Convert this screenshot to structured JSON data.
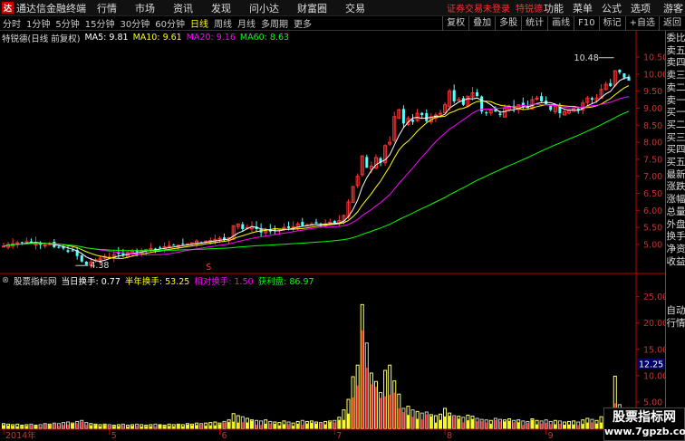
{
  "app": {
    "title": "通达信金融终端",
    "logo_glyph": "达"
  },
  "menu": [
    "行情",
    "市场",
    "资讯",
    "发现",
    "问小达",
    "财富圈",
    "交易"
  ],
  "notice": {
    "text": "证券交易未登录",
    "name": "特锐德"
  },
  "right_menu": [
    "功能",
    "菜单",
    "公式",
    "选项",
    "游客"
  ],
  "periods": [
    {
      "label": "分时",
      "active": false
    },
    {
      "label": "1分钟",
      "active": false
    },
    {
      "label": "5分钟",
      "active": false
    },
    {
      "label": "15分钟",
      "active": false
    },
    {
      "label": "30分钟",
      "active": false
    },
    {
      "label": "60分钟",
      "active": false
    },
    {
      "label": "日线",
      "active": true
    },
    {
      "label": "周线",
      "active": false
    },
    {
      "label": "月线",
      "active": false
    },
    {
      "label": "多周期",
      "active": false
    },
    {
      "label": "更多",
      "active": false
    }
  ],
  "tools": [
    "复权",
    "叠加",
    "多股",
    "统计",
    "画线",
    "F10",
    "标记",
    "+自选",
    "返回"
  ],
  "ma_line": {
    "stock": "特锐德(日线 前复权)",
    "items": [
      {
        "label": "MA5: 9.81",
        "color": "#ffffff"
      },
      {
        "label": "MA10: 9.61",
        "color": "#ffff00"
      },
      {
        "label": "MA20: 9.16",
        "color": "#ff00ff"
      },
      {
        "label": "MA60: 8.63",
        "color": "#00ff00"
      }
    ]
  },
  "indicator_line": {
    "name": "股票指标网",
    "items": [
      {
        "label": "当日换手: 0.77",
        "color": "#ffffff"
      },
      {
        "label": "半年换手: 53.25",
        "color": "#ffff00"
      },
      {
        "label": "相对换手: 1.50",
        "color": "#ff00ff"
      },
      {
        "label": "获利盘: 86.97",
        "color": "#00ff00"
      }
    ]
  },
  "price_axis": [
    "10.50",
    "10.00",
    "9.50",
    "9.00",
    "8.50",
    "8.00",
    "7.50",
    "7.00",
    "6.50",
    "6.00",
    "5.50",
    "5.00"
  ],
  "volume_axis": [
    "25.00",
    "20.00",
    "15.00",
    "10.00",
    "5.00"
  ],
  "current_label": "12.25",
  "date_axis": [
    "2014年",
    "5",
    "6",
    "7",
    "8",
    "9"
  ],
  "annotations": {
    "high": "10.48",
    "low": "4.38",
    "s_mark": "S"
  },
  "sidebar_top": [
    "委比",
    "卖五",
    "卖四",
    "卖三",
    "卖二",
    "卖一",
    "买一",
    "买二",
    "买三",
    "买四",
    "买五",
    "最新",
    "涨跌",
    "涨幅",
    "总量",
    "外盘",
    "换手",
    "净资",
    "收益"
  ],
  "sidebar_bottom": [
    "自动",
    "行情"
  ],
  "watermark": {
    "title": "股票指标网",
    "url": "www.7gpzb.com"
  },
  "colors": {
    "up": "#ff3232",
    "down": "#54ffff",
    "ma5": "#ffffff",
    "ma10": "#ffff00",
    "ma20": "#ff00ff",
    "ma60": "#00ff00",
    "axis": "#c00000"
  },
  "chart_data": [
    {
      "type": "candlestick",
      "title": "特锐德(日线 前复权)",
      "ylim": [
        4.2,
        10.9
      ],
      "x_labels": [
        "2014年",
        "5",
        "6",
        "7",
        "8",
        "9"
      ],
      "closes": [
        4.95,
        5.0,
        5.02,
        5.05,
        5.05,
        5.08,
        5.04,
        5.06,
        5.0,
        4.98,
        5.02,
        4.92,
        4.9,
        4.88,
        4.78,
        4.82,
        4.66,
        4.5,
        4.4,
        4.48,
        4.55,
        4.6,
        4.65,
        4.63,
        4.7,
        4.72,
        4.7,
        4.76,
        4.8,
        4.78,
        4.82,
        4.85,
        4.88,
        4.86,
        4.9,
        4.93,
        4.95,
        4.97,
        4.98,
        5.0,
        5.02,
        5.05,
        5.1,
        5.05,
        5.1,
        5.12,
        5.15,
        5.18,
        5.14,
        5.2,
        5.55,
        5.6,
        5.45,
        5.5,
        5.52,
        5.45,
        5.35,
        5.4,
        5.38,
        5.42,
        5.45,
        5.5,
        5.48,
        5.52,
        5.6,
        5.55,
        5.58,
        5.6,
        5.62,
        5.58,
        5.6,
        5.65,
        5.62,
        5.7,
        5.85,
        6.25,
        6.7,
        7.0,
        7.6,
        7.25,
        7.3,
        7.55,
        7.4,
        7.9,
        8.0,
        8.75,
        8.95,
        8.55,
        8.7,
        8.6,
        8.85,
        8.8,
        8.62,
        8.75,
        8.8,
        8.85,
        9.1,
        9.5,
        9.2,
        9.25,
        9.1,
        9.35,
        9.45,
        9.35,
        8.9,
        8.85,
        8.95,
        8.9,
        8.8,
        9.0,
        9.05,
        9.0,
        9.1,
        9.05,
        9.0,
        9.25,
        9.3,
        9.2,
        9.1,
        8.95,
        9.05,
        8.85,
        8.9,
        8.95,
        9.0,
        8.95,
        9.15,
        9.3,
        9.25,
        9.3,
        9.55,
        9.7,
        9.65,
        10.1,
        10.05,
        9.9,
        9.81
      ],
      "ma_colors": {
        "MA5": "#ffffff",
        "MA10": "#ffff00",
        "MA20": "#ff00ff",
        "MA60": "#00ff00"
      }
    },
    {
      "type": "bar",
      "title": "股票指标网",
      "ylim": [
        0,
        27
      ],
      "series": [
        {
          "name": "当日换手",
          "values": [
            0.9,
            0.8,
            0.7,
            0.8,
            0.6,
            0.7,
            0.8,
            0.6,
            0.7,
            0.9,
            0.8,
            1.0,
            0.9,
            1.1,
            1.2,
            1.0,
            1.3,
            1.5,
            1.1,
            0.9,
            0.8,
            0.7,
            0.8,
            0.7,
            0.6,
            0.7,
            0.8,
            0.6,
            0.7,
            0.8,
            0.7,
            0.6,
            0.7,
            0.8,
            0.7,
            0.6,
            0.8,
            0.7,
            0.8,
            0.7,
            0.9,
            0.8,
            1.0,
            0.9,
            1.0,
            1.1,
            1.2,
            1.0,
            1.3,
            1.6,
            2.8,
            2.4,
            2.2,
            1.9,
            1.6,
            1.5,
            1.4,
            1.6,
            1.3,
            1.2,
            1.1,
            1.4,
            1.2,
            1.0,
            1.3,
            1.5,
            1.3,
            1.4,
            1.2,
            1.1,
            1.3,
            1.4,
            1.5,
            2.1,
            3.5,
            5.5,
            9.8,
            12.0,
            23.5,
            16.2,
            10.5,
            8.9,
            6.8,
            11.0,
            12.0,
            9.0,
            6.5,
            3.8,
            4.2,
            3.5,
            3.2,
            2.9,
            3.1,
            2.6,
            2.4,
            2.7,
            3.8,
            2.9,
            2.4,
            2.3,
            2.1,
            2.5,
            2.3,
            1.9,
            1.7,
            1.6,
            1.5,
            1.9,
            1.7,
            1.6,
            1.8,
            1.5,
            1.6,
            1.4,
            1.3,
            1.8,
            1.5,
            1.4,
            1.6,
            1.3,
            1.5,
            1.4,
            1.2,
            1.3,
            1.4,
            1.2,
            1.6,
            1.9,
            1.7,
            1.5,
            2.2,
            2.5,
            2.1,
            9.9,
            4.5,
            2.8,
            0.77
          ]
        }
      ],
      "ylabel": ""
    }
  ]
}
